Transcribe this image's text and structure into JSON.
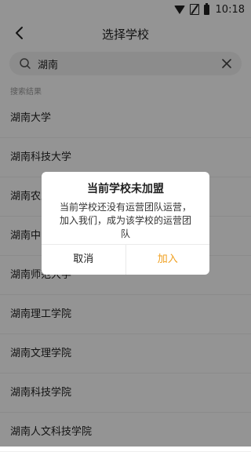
{
  "status_bar": {
    "time": "10:18"
  },
  "header": {
    "title": "选择学校"
  },
  "search": {
    "value": "湖南"
  },
  "results_label": "搜索结果",
  "results": [
    "湖南大学",
    "湖南科技大学",
    "湖南农业大学",
    "湖南中医药大学",
    "湖南师范大学",
    "湖南理工学院",
    "湖南文理学院",
    "湖南科技学院",
    "湖南人文科技学院"
  ],
  "dialog": {
    "title": "当前学校未加盟",
    "message": "当前学校还没有运营团队运营，加入我们，成为该学校的运营团队",
    "cancel_label": "取消",
    "join_label": "加入"
  },
  "colors": {
    "accent": "#f0a020",
    "overlay": "rgba(0,0,0,0.42)"
  }
}
